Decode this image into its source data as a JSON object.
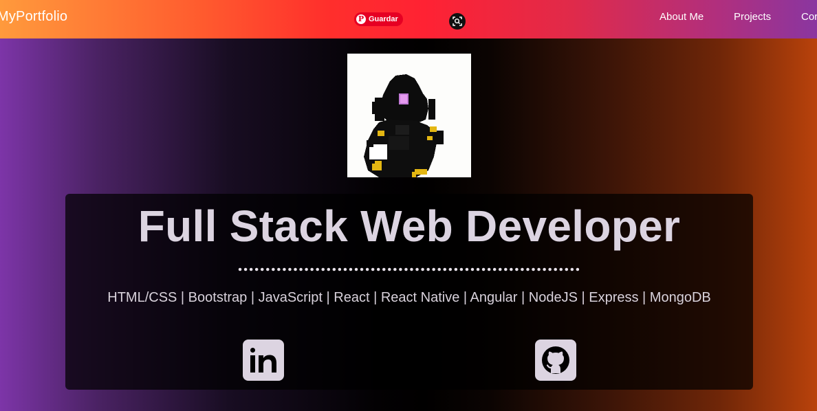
{
  "navbar": {
    "brand": "MyPortfolio",
    "pinterest_label": "Guardar",
    "links": [
      {
        "label": "About Me"
      },
      {
        "label": "Projects"
      },
      {
        "label": "Cor"
      }
    ]
  },
  "hero": {
    "title": "Full Stack Web Developer",
    "skills": "HTML/CSS | Bootstrap | JavaScript | React | React Native | Angular | NodeJS | Express | MongoDB"
  },
  "social": [
    {
      "icon": "linkedin-icon"
    },
    {
      "icon": "github-icon"
    }
  ],
  "colors": {
    "pinterest": "#e60023",
    "text_light": "#dcd4e1",
    "navbar_start": "#ff9a3c",
    "navbar_end": "#8a36a0"
  }
}
